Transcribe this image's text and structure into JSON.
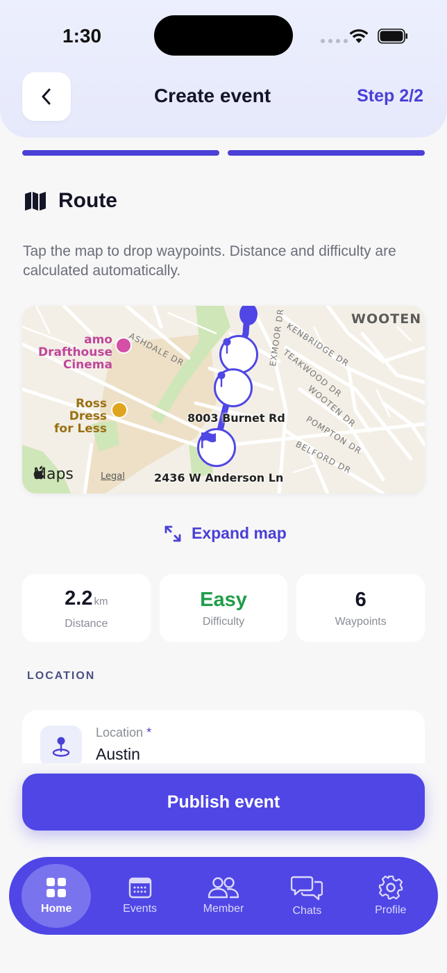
{
  "status": {
    "time": "1:30"
  },
  "header": {
    "title": "Create event",
    "step": "Step 2/2"
  },
  "route": {
    "heading": "Route",
    "description": "Tap the map to drop waypoints. Distance and difficulty are calculated automatically."
  },
  "map": {
    "labels": {
      "wooten": "WOOTEN",
      "cinema_1": "amo Drafthouse",
      "cinema_2": "Cinema",
      "ross_1": "Ross Dress",
      "ross_2": "for Less",
      "ashdale": "ASHDALE DR",
      "exmoor": "EXMOOR DR",
      "kenbridge": "KENBRIDGE DR",
      "teakwood": "TEAKWOOD DR",
      "wooten_dr": "WOOTEN DR",
      "pompton": "POMPTON DR",
      "belford": "BELFORD DR",
      "burnet": "8003 Burnet Rd",
      "anderson": "2436 W Anderson Ln",
      "maps": "Maps",
      "legal": "Legal"
    }
  },
  "expand_map": "Expand map",
  "stats": [
    {
      "value": "2.2",
      "unit": "km",
      "label": "Distance",
      "color": "#141526"
    },
    {
      "value": "Easy",
      "unit": "",
      "label": "Difficulty",
      "color": "#1f9d4a"
    },
    {
      "value": "6",
      "unit": "",
      "label": "Waypoints",
      "color": "#141526"
    }
  ],
  "location": {
    "section_label": "LOCATION",
    "field_label": "Location",
    "required_mark": "*",
    "value": "Austin"
  },
  "publish_label": "Publish event",
  "nav": [
    {
      "label": "Home",
      "icon": "grid-icon",
      "active": true
    },
    {
      "label": "Events",
      "icon": "calendar-icon",
      "active": false
    },
    {
      "label": "Member",
      "icon": "users-icon",
      "active": false
    },
    {
      "label": "Chats",
      "icon": "chat-icon",
      "active": false
    },
    {
      "label": "Profile",
      "icon": "gear-icon",
      "active": false
    }
  ],
  "colors": {
    "accent": "#4f46e5",
    "accent_text": "#4a3fd6",
    "easy": "#1f9d4a"
  }
}
